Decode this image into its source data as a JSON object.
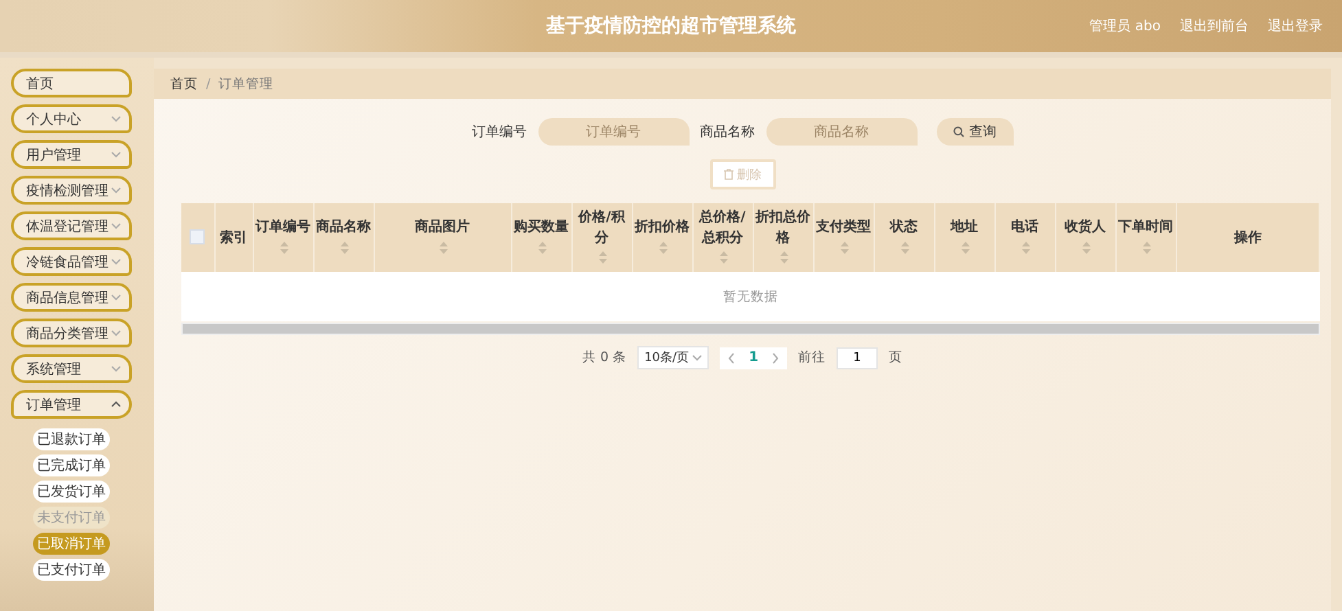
{
  "header": {
    "title": "基于疫情防控的超市管理系统",
    "user": "管理员 abo",
    "links": [
      "退出到前台",
      "退出登录"
    ]
  },
  "sidebar": {
    "items": [
      {
        "label": "首页",
        "kind": "link"
      },
      {
        "label": "个人中心",
        "kind": "submenu",
        "expanded": false
      },
      {
        "label": "用户管理",
        "kind": "submenu",
        "expanded": false
      },
      {
        "label": "疫情检测管理",
        "kind": "submenu",
        "expanded": false
      },
      {
        "label": "体温登记管理",
        "kind": "submenu",
        "expanded": false
      },
      {
        "label": "冷链食品管理",
        "kind": "submenu",
        "expanded": false
      },
      {
        "label": "商品信息管理",
        "kind": "submenu",
        "expanded": false
      },
      {
        "label": "商品分类管理",
        "kind": "submenu",
        "expanded": false
      },
      {
        "label": "系统管理",
        "kind": "submenu",
        "expanded": false
      },
      {
        "label": "订单管理",
        "kind": "submenu",
        "expanded": true,
        "children": [
          {
            "label": "已退款订单",
            "selected": false,
            "highlighted": false
          },
          {
            "label": "已完成订单",
            "selected": false,
            "highlighted": false
          },
          {
            "label": "已发货订单",
            "selected": false,
            "highlighted": false
          },
          {
            "label": "未支付订单",
            "selected": false,
            "highlighted": true
          },
          {
            "label": "已取消订单",
            "selected": true,
            "highlighted": false
          },
          {
            "label": "已支付订单",
            "selected": false,
            "highlighted": false
          }
        ]
      }
    ]
  },
  "breadcrumb": {
    "items": [
      "首页",
      "订单管理"
    ],
    "separator": "/"
  },
  "search": {
    "fields": [
      {
        "label": "订单编号",
        "placeholder": "订单编号"
      },
      {
        "label": "商品名称",
        "placeholder": "商品名称"
      }
    ],
    "button": "查询"
  },
  "toolbar": {
    "delete_button": {
      "label": "删除",
      "disabled": true
    }
  },
  "table": {
    "select_all": {
      "checked": false
    },
    "columns": [
      {
        "label": "索引",
        "sortable": false
      },
      {
        "label": "订单编号",
        "sortable": true
      },
      {
        "label": "商品名称",
        "sortable": true
      },
      {
        "label": "商品图片",
        "sortable": true
      },
      {
        "label": "购买数量",
        "sortable": true
      },
      {
        "label": "价格/积分",
        "sortable": true
      },
      {
        "label": "折扣价格",
        "sortable": true
      },
      {
        "label": "总价格/总积分",
        "sortable": true
      },
      {
        "label": "折扣总价格",
        "sortable": true
      },
      {
        "label": "支付类型",
        "sortable": true
      },
      {
        "label": "状态",
        "sortable": true
      },
      {
        "label": "地址",
        "sortable": true
      },
      {
        "label": "电话",
        "sortable": true
      },
      {
        "label": "收货人",
        "sortable": true
      },
      {
        "label": "下单时间",
        "sortable": true
      },
      {
        "label": "操作",
        "sortable": false
      }
    ],
    "empty_text": "暂无数据"
  },
  "pagination": {
    "total": "共 0 条",
    "page_size": "10条/页",
    "pages": [
      {
        "label": "1",
        "selected": true
      }
    ],
    "goto_label": "前往",
    "goto_value": "1",
    "goto_suffix": "页"
  }
}
